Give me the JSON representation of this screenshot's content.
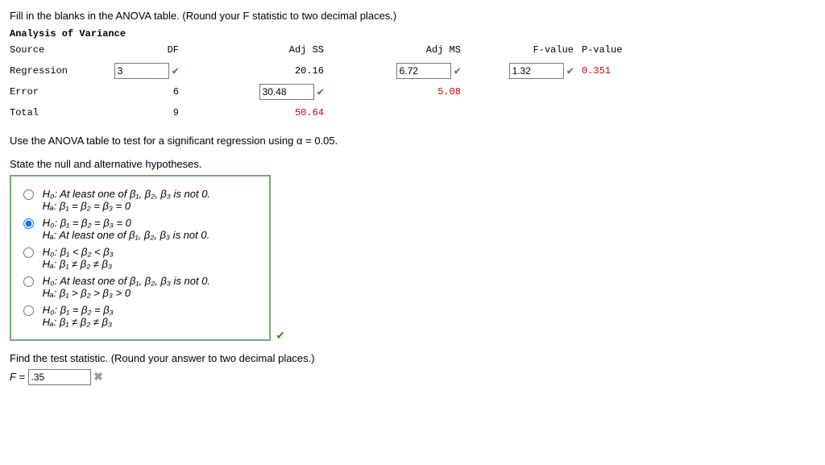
{
  "title": "Fill in the blanks in the ANOVA table. (Round your F statistic to two decimal places.)",
  "subtitle": "Analysis of Variance",
  "headers": {
    "source": "Source",
    "df": "DF",
    "adjss": "Adj SS",
    "adjms": "Adj MS",
    "fval": "F-value",
    "pval": "P-value"
  },
  "rows": {
    "regression": {
      "label": "Regression",
      "df": "3",
      "adjss": "20.16",
      "adjms": "6.72",
      "fval": "1.32",
      "pval": "0.351"
    },
    "error": {
      "label": "Error",
      "df": "6",
      "adjss": "30.48",
      "adjms": "5.08"
    },
    "total": {
      "label": "Total",
      "df": "9",
      "adjss": "50.64"
    }
  },
  "instr2": "Use the ANOVA table to test for a significant regression using α = 0.05.",
  "instr3": "State the null and alternative hypotheses.",
  "opts": {
    "o1h0": "H₀: At least one of β₁, β₂, β₃ is not 0.",
    "o1ha": "Hₐ: β₁ = β₂ = β₃ = 0",
    "o2h0": "H₀: β₁ = β₂ = β₃ = 0",
    "o2ha": "Hₐ: At least one of β₁, β₂, β₃ is not 0.",
    "o3h0": "H₀: β₁ < β₂ < β₃",
    "o3ha": "Hₐ: β₁ ≠ β₂ ≠ β₃",
    "o4h0": "H₀: At least one of β₁, β₂, β₃ is not 0.",
    "o4ha": "Hₐ: β₁ > β₂ > β₃ > 0",
    "o5h0": "H₀: β₁ = β₂ = β₃",
    "o5ha": "Hₐ: β₁ ≠ β₂ ≠ β₃"
  },
  "instr4": "Find the test statistic. (Round your answer to two decimal places.)",
  "fLabel": "F = ",
  "fValue": ".35",
  "marks": {
    "check": "✔",
    "cross": "✖"
  }
}
